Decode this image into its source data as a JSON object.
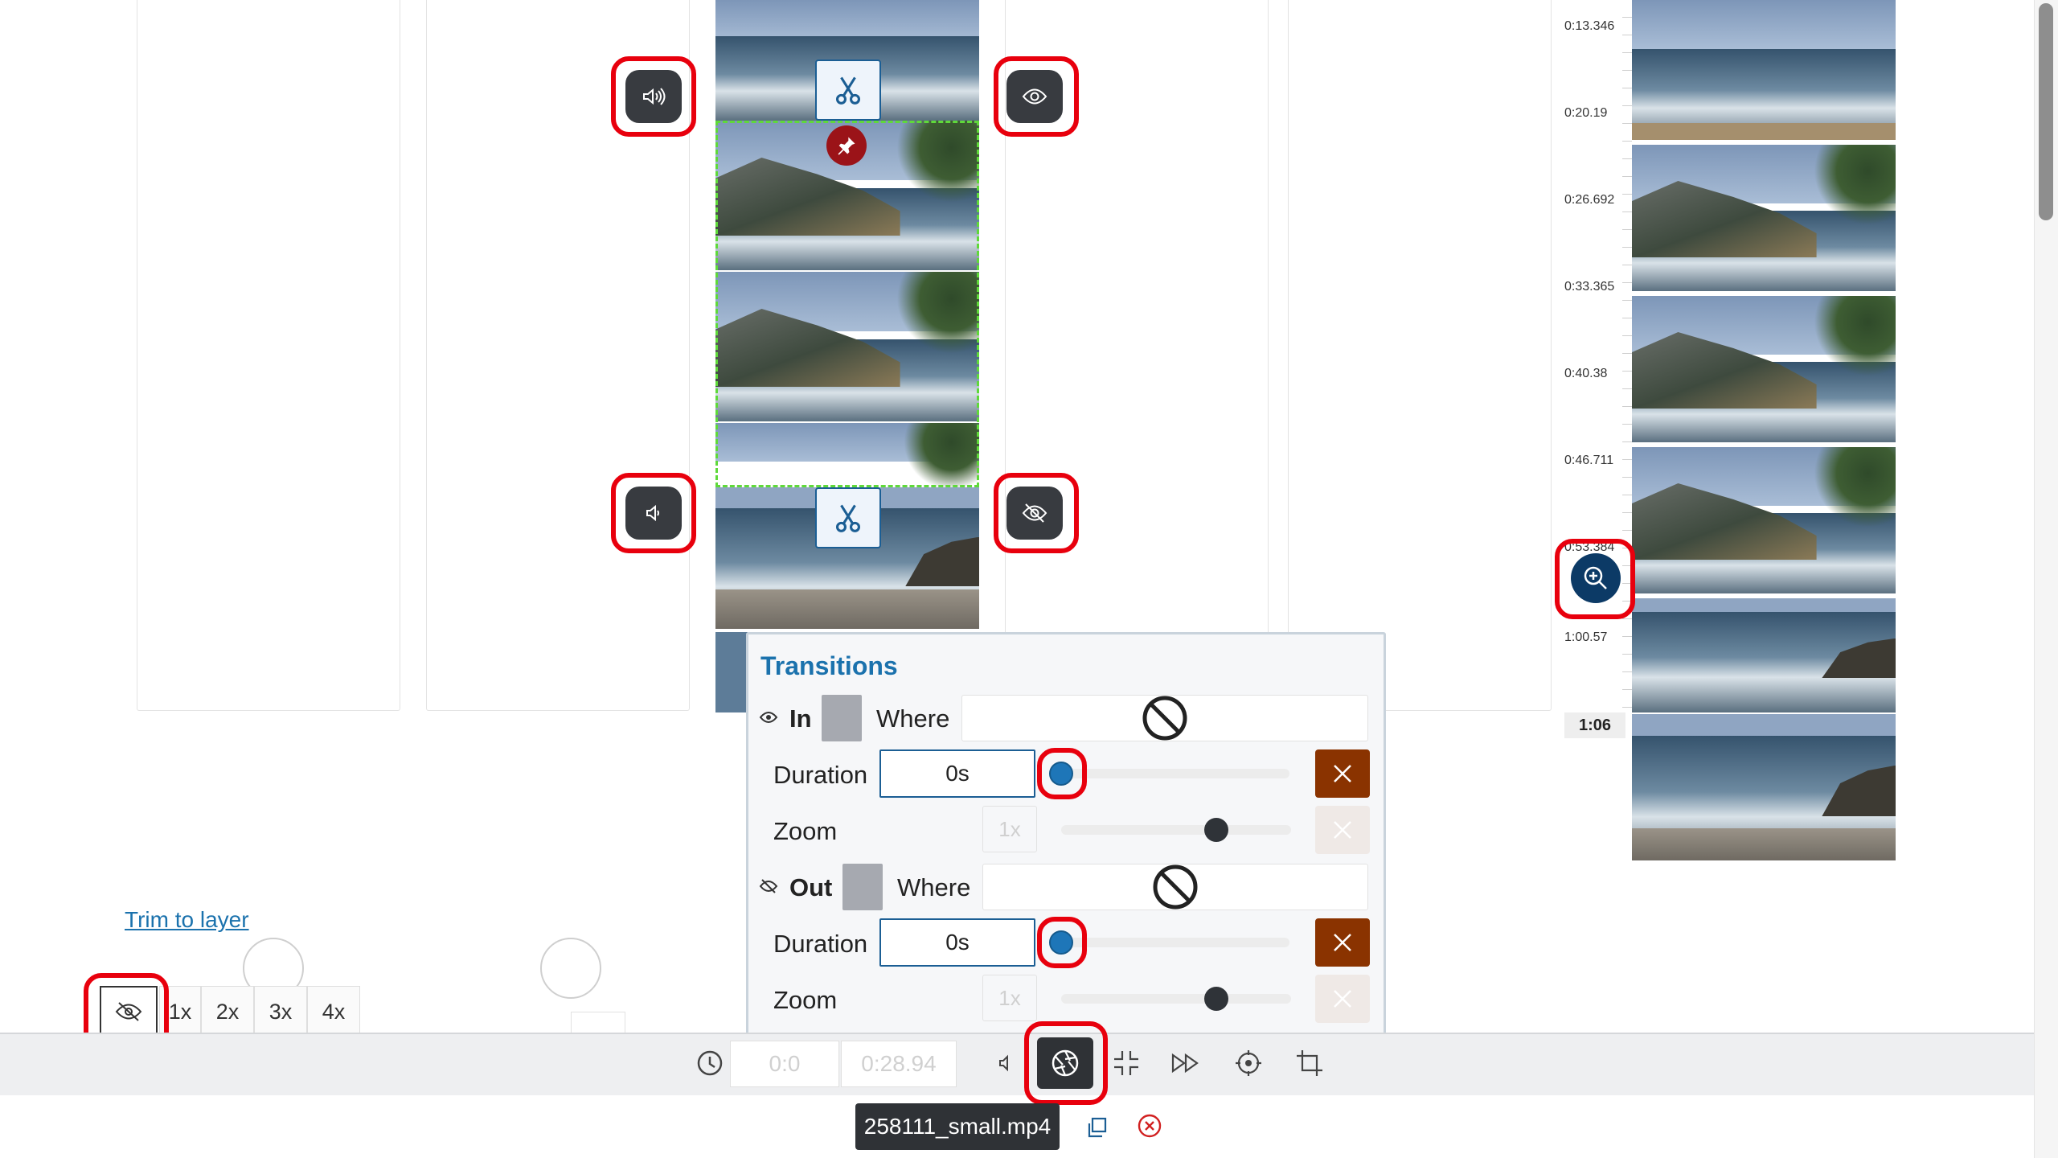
{
  "trim_link": "Trim to layer",
  "speed_buttons": [
    "1x",
    "2x",
    "3x",
    "4x"
  ],
  "timestamps": [
    "0:13.346",
    "0:20.19",
    "0:26.692",
    "0:33.365",
    "0:40.38",
    "0:46.711",
    "0:53.384",
    "1:00.57"
  ],
  "duration_badge": "1:06",
  "transitions": {
    "title": "Transitions",
    "in": {
      "label": "In",
      "where_label": "Where",
      "duration_label": "Duration",
      "duration_value": "0s",
      "duration_fraction": 0,
      "zoom_label": "Zoom",
      "zoom_value": "1x",
      "zoom_fraction": 0.68
    },
    "out": {
      "label": "Out",
      "where_label": "Where",
      "duration_label": "Duration",
      "duration_value": "0s",
      "duration_fraction": 0,
      "zoom_label": "Zoom",
      "zoom_value": "1x",
      "zoom_fraction": 0.68
    }
  },
  "toolbar": {
    "start_time": "0:0",
    "end_time": "0:28.94"
  },
  "file": {
    "name": "258111_small.mp4"
  },
  "colors": {
    "accent": "#1b5e94",
    "highlight": "#e8000d",
    "delete": "#8a3300",
    "knob_blue": "#1e76b8",
    "dark_button": "#383b40"
  }
}
